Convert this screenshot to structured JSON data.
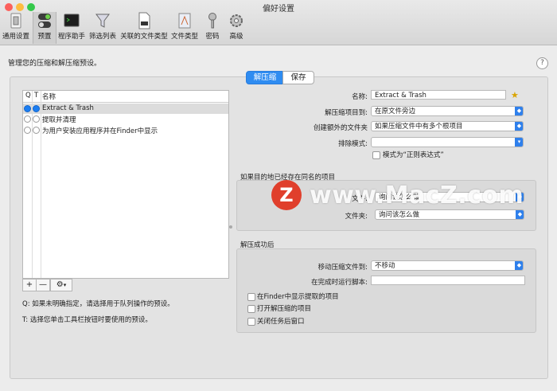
{
  "window": {
    "title": "偏好设置"
  },
  "traffic_lights": [
    "#fc605c",
    "#fdbc40",
    "#34c84a"
  ],
  "toolbar": {
    "items": [
      {
        "label": "通用设置",
        "icon": "light-switch-icon"
      },
      {
        "label": "预置",
        "icon": "toggle-switch-icon"
      },
      {
        "label": "程序助手",
        "icon": "terminal-icon"
      },
      {
        "label": "筛选列表",
        "icon": "funnel-icon"
      },
      {
        "label": "关联的文件类型",
        "icon": "zip-file-icon"
      },
      {
        "label": "文件类型",
        "icon": "document-type-icon"
      },
      {
        "label": "密码",
        "icon": "key-icon"
      },
      {
        "label": "高级",
        "icon": "gear-icon"
      }
    ]
  },
  "description": "管理您的压缩和解压缩预设。",
  "help": "?",
  "segments": {
    "extract": "解压缩",
    "save": "保存"
  },
  "list": {
    "headers": {
      "q": "Q",
      "t": "T",
      "name": "名称"
    },
    "rows": [
      {
        "name": "Extract & Trash",
        "selected": true
      },
      {
        "name": "提取并清理",
        "selected": false
      },
      {
        "name": "为用户安装应用程序并在Finder中显示",
        "selected": false
      }
    ],
    "buttons": {
      "add": "+",
      "remove": "—"
    }
  },
  "notes": {
    "q": "Q:  如果未明确指定，请选择用于队列操作的预设。",
    "t": "T:  选择您单击工具栏按钮时要使用的预设。"
  },
  "form": {
    "name_label": "名称:",
    "name_value": "Extract & Trash",
    "extract_to_label": "解压缩项目到:",
    "extract_to_value": "在原文件旁边",
    "create_folder_label": "创建额外的文件夹",
    "create_folder_value": "如果压缩文件中有多个根项目",
    "exclude_label": "排除模式:",
    "exclude_value": "",
    "regex_label": "模式为“正则表达式”",
    "exists_section": "如果目的地已经存在同名的项目",
    "file_label": "文件:",
    "file_value": "询问该怎么做",
    "folder_label": "文件夹:",
    "folder_value": "询问该怎么做",
    "after_section": "解压成功后",
    "move_label": "移动压缩文件到:",
    "move_value": "不移动",
    "script_label": "在完成时运行脚本:",
    "script_value": "",
    "check_finder": "在Finder中显示提取的项目",
    "check_open": "打开解压缩的项目",
    "check_close": "关闭任务后窗口"
  },
  "watermark": {
    "logo": "Z",
    "text": "www.MacZ.com"
  }
}
